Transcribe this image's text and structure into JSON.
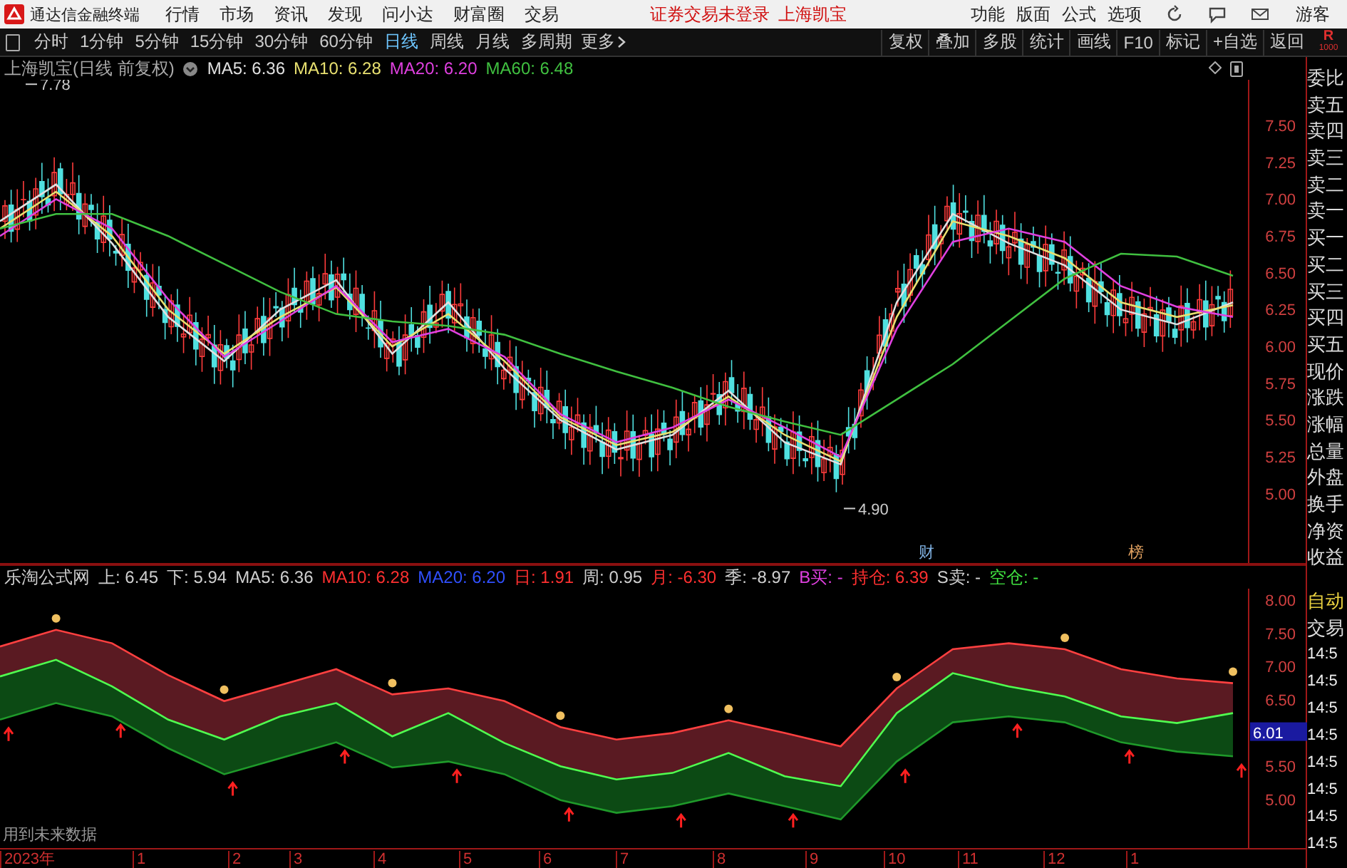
{
  "title_bar": {
    "app_name": "通达信金融终端",
    "menu": [
      "行情",
      "市场",
      "资讯",
      "发现",
      "问小达",
      "财富圈",
      "交易"
    ],
    "notice": "证券交易未登录",
    "stock": "上海凯宝",
    "tools": [
      "功能",
      "版面",
      "公式",
      "选项"
    ],
    "user": "游客"
  },
  "toolbar": {
    "periods": [
      {
        "label": "分时",
        "selected": false
      },
      {
        "label": "1分钟",
        "selected": false
      },
      {
        "label": "5分钟",
        "selected": false
      },
      {
        "label": "15分钟",
        "selected": false
      },
      {
        "label": "30分钟",
        "selected": false
      },
      {
        "label": "60分钟",
        "selected": false
      },
      {
        "label": "日线",
        "selected": true
      },
      {
        "label": "周线",
        "selected": false
      },
      {
        "label": "月线",
        "selected": false
      },
      {
        "label": "多周期",
        "selected": false
      }
    ],
    "more": "更多",
    "actions": [
      "复权",
      "叠加",
      "多股",
      "统计",
      "画线",
      "F10",
      "标记",
      "+自选",
      "返回"
    ],
    "badge": "R",
    "badge_sub": "1000"
  },
  "price_panel": {
    "title": "上海凯宝(日线 前复权)",
    "chart_data": {
      "type": "line",
      "ylim": [
        4.53,
        7.81
      ],
      "yticks": [
        {
          "value": 7.5,
          "label": "7.50"
        },
        {
          "value": 7.25,
          "label": "7.25"
        },
        {
          "value": 7,
          "label": "7.00"
        },
        {
          "value": 6.75,
          "label": "6.75"
        },
        {
          "value": 6.5,
          "label": "6.50"
        },
        {
          "value": 6.25,
          "label": "6.25"
        },
        {
          "value": 6,
          "label": "6.00"
        },
        {
          "value": 5.75,
          "label": "5.75"
        },
        {
          "value": 5.5,
          "label": "5.50"
        },
        {
          "value": 5.25,
          "label": "5.25"
        },
        {
          "value": 5,
          "label": "5.00"
        }
      ],
      "series": [
        {
          "name": "MA5",
          "color": "#e0e0e0",
          "values": [
            6.85,
            7.1,
            6.7,
            6.2,
            5.9,
            6.25,
            6.45,
            5.95,
            6.3,
            5.85,
            5.5,
            5.3,
            5.4,
            5.7,
            5.35,
            5.2,
            6.3,
            6.9,
            6.7,
            6.55,
            6.25,
            6.15,
            6.3
          ]
        },
        {
          "name": "MA10",
          "color": "#e8e070",
          "values": [
            6.8,
            7.05,
            6.75,
            6.25,
            5.95,
            6.2,
            6.4,
            6.0,
            6.22,
            5.9,
            5.52,
            5.33,
            5.42,
            5.66,
            5.4,
            5.22,
            6.2,
            6.85,
            6.75,
            6.6,
            6.3,
            6.2,
            6.28
          ]
        },
        {
          "name": "MA20",
          "color": "#e040e0",
          "values": [
            6.75,
            7.0,
            6.8,
            6.32,
            5.93,
            6.17,
            6.41,
            6.03,
            6.12,
            5.93,
            5.54,
            5.35,
            5.45,
            5.64,
            5.45,
            5.25,
            6.12,
            6.71,
            6.8,
            6.71,
            6.41,
            6.27,
            6.2
          ]
        },
        {
          "name": "MA60",
          "color": "#40c040",
          "values": [
            6.8,
            6.9,
            6.9,
            6.75,
            6.56,
            6.37,
            6.22,
            6.17,
            6.14,
            6.08,
            5.95,
            5.83,
            5.72,
            5.59,
            5.49,
            5.4,
            5.64,
            5.88,
            6.17,
            6.46,
            6.63,
            6.61,
            6.48
          ]
        }
      ]
    },
    "legend_values": [
      {
        "value": ": 6.36",
        "color": "#e0e0e0"
      },
      {
        "value": ": 6.28",
        "color": "#e8e070"
      },
      {
        "value": ": 6.20",
        "color": "#e040e0"
      },
      {
        "value": ": 6.48",
        "color": "#40c040"
      }
    ],
    "high_label": "7.78",
    "low_label": "4.90",
    "event_marks": [
      {
        "text": "财",
        "color": "#7fb0e0"
      },
      {
        "text": "榜",
        "color": "#e0a060"
      }
    ]
  },
  "indicator_panel": {
    "title": "乐淘公式网",
    "chart_data": {
      "type": "line",
      "ylim": [
        4.27,
        8.17
      ],
      "yticks": [
        {
          "value": 8,
          "label": "8.00"
        },
        {
          "value": 7.5,
          "label": "7.50"
        },
        {
          "value": 7,
          "label": "7.00"
        },
        {
          "value": 6.5,
          "label": "6.50"
        },
        {
          "value": 5.5,
          "label": "5.50"
        },
        {
          "value": 5,
          "label": "5.00"
        }
      ],
      "series": [
        {
          "name": "上",
          "color": "#ff4040",
          "values": [
            7.3,
            7.55,
            7.35,
            6.87,
            6.48,
            6.72,
            6.96,
            6.58,
            6.67,
            6.48,
            6.09,
            5.9,
            6.0,
            6.19,
            6.0,
            5.8,
            6.67,
            7.26,
            7.35,
            7.26,
            6.96,
            6.82,
            6.75
          ]
        },
        {
          "name": "下",
          "color": "#1f9a2a",
          "values": [
            6.2,
            6.45,
            6.25,
            5.77,
            5.38,
            5.62,
            5.86,
            5.48,
            5.57,
            5.38,
            4.99,
            4.8,
            4.9,
            5.09,
            4.9,
            4.7,
            5.57,
            6.16,
            6.25,
            6.16,
            5.86,
            5.72,
            5.65
          ]
        },
        {
          "name": "MA5",
          "color": "#50ff50",
          "values": [
            6.85,
            7.1,
            6.7,
            6.2,
            5.9,
            6.25,
            6.45,
            5.95,
            6.3,
            5.85,
            5.5,
            5.3,
            5.4,
            5.7,
            5.35,
            5.2,
            6.3,
            6.9,
            6.7,
            6.55,
            6.25,
            6.15,
            6.3
          ]
        }
      ]
    },
    "legend_values": [
      {
        "value": ": 6.45",
        "color": "#d0d0d0"
      },
      {
        "value": ": 5.94",
        "color": "#d0d0d0"
      },
      {
        "value": ": 6.36",
        "color": "#d0d0d0"
      }
    ],
    "stats": [
      {
        "label": "MA10: 6.28",
        "color": "#ff3030"
      },
      {
        "label": "MA20: 6.20",
        "color": "#3050ff"
      },
      {
        "label": "日: 1.91",
        "color": "#ff3030"
      },
      {
        "label": "周: 0.95",
        "color": "#d0d0d0"
      },
      {
        "label": "月: -6.30",
        "color": "#ff3030"
      },
      {
        "label": "季: -8.97",
        "color": "#d0d0d0"
      },
      {
        "label": "B买: -",
        "color": "#e040e0"
      },
      {
        "label": "持仓: 6.39",
        "color": "#ff3030"
      },
      {
        "label": "S卖: -",
        "color": "#d0d0d0"
      },
      {
        "label": "空仓: -",
        "color": "#40e040"
      }
    ],
    "current_value": "6.01",
    "note": "用到未来数据"
  },
  "x_axis": [
    "2023年",
    "1",
    "2",
    "3",
    "4",
    "5",
    "6",
    "7",
    "8",
    "9",
    "10",
    "11",
    "12",
    "1"
  ],
  "side_panel": [
    {
      "label": "委比",
      "kind": "quote"
    },
    {
      "label": "卖五",
      "kind": "quote"
    },
    {
      "label": "卖四",
      "kind": "quote"
    },
    {
      "label": "卖三",
      "kind": "quote"
    },
    {
      "label": "卖二",
      "kind": "quote"
    },
    {
      "label": "卖一",
      "kind": "quote"
    },
    {
      "label": "买一",
      "kind": "quote"
    },
    {
      "label": "买二",
      "kind": "quote"
    },
    {
      "label": "买三",
      "kind": "quote"
    },
    {
      "label": "买四",
      "kind": "quote"
    },
    {
      "label": "买五",
      "kind": "quote"
    },
    {
      "label": "现价",
      "kind": "quote"
    },
    {
      "label": "涨跌",
      "kind": "quote"
    },
    {
      "label": "涨幅",
      "kind": "quote"
    },
    {
      "label": "总量",
      "kind": "quote"
    },
    {
      "label": "外盘",
      "kind": "quote"
    },
    {
      "label": "换手",
      "kind": "quote"
    },
    {
      "label": "净资",
      "kind": "quote"
    },
    {
      "label": "收益",
      "kind": "quote"
    },
    {
      "label": "自动",
      "kind": "tab"
    },
    {
      "label": "交易",
      "kind": "header"
    },
    {
      "label": "14:5",
      "kind": "time"
    },
    {
      "label": "14:5",
      "kind": "time"
    },
    {
      "label": "14:5",
      "kind": "time"
    },
    {
      "label": "14:5",
      "kind": "time"
    },
    {
      "label": "14:5",
      "kind": "time"
    },
    {
      "label": "14:5",
      "kind": "time"
    },
    {
      "label": "14:5",
      "kind": "time"
    },
    {
      "label": "14:5",
      "kind": "time"
    }
  ]
}
